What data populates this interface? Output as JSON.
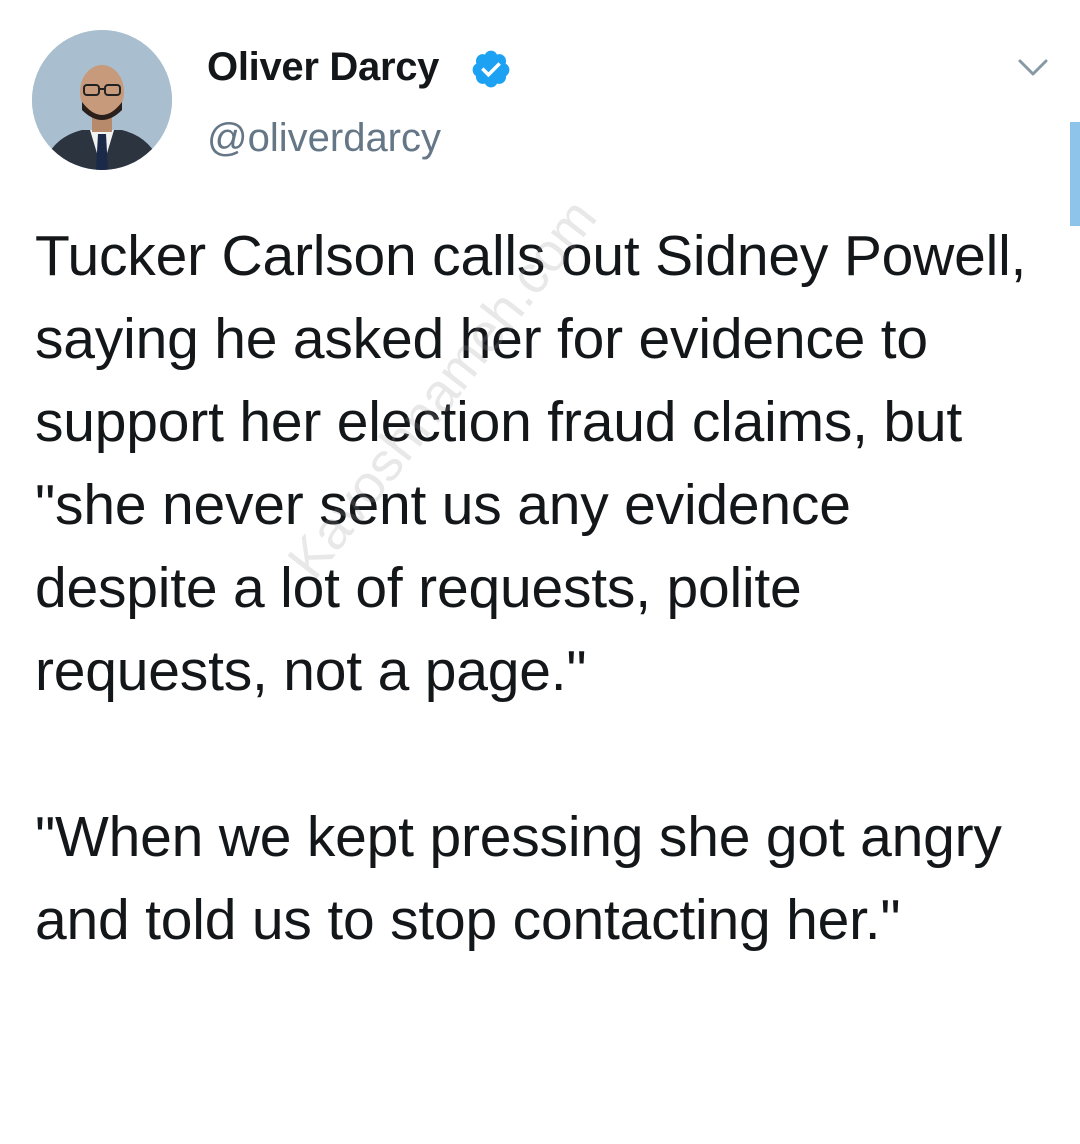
{
  "author": {
    "display_name": "Oliver Darcy",
    "handle": "@oliverdarcy",
    "verified": true
  },
  "tweet": {
    "paragraph_1": "Tucker Carlson calls out Sidney Powell, saying he asked her for evidence to support her election fraud claims, but \"she never sent us any evidence despite a lot of requests, polite requests, not a page.\"",
    "paragraph_2": "\"When we kept pressing she got angry and told us to stop contacting her.\""
  },
  "watermark": "Kavoshnameh.com",
  "icons": {
    "menu": "chevron-down-icon",
    "verified": "verified-badge-icon"
  },
  "colors": {
    "verified_blue": "#1da1f2",
    "handle_gray": "#657786",
    "text": "#14171a",
    "scrollbar": "#8ec3ea"
  }
}
